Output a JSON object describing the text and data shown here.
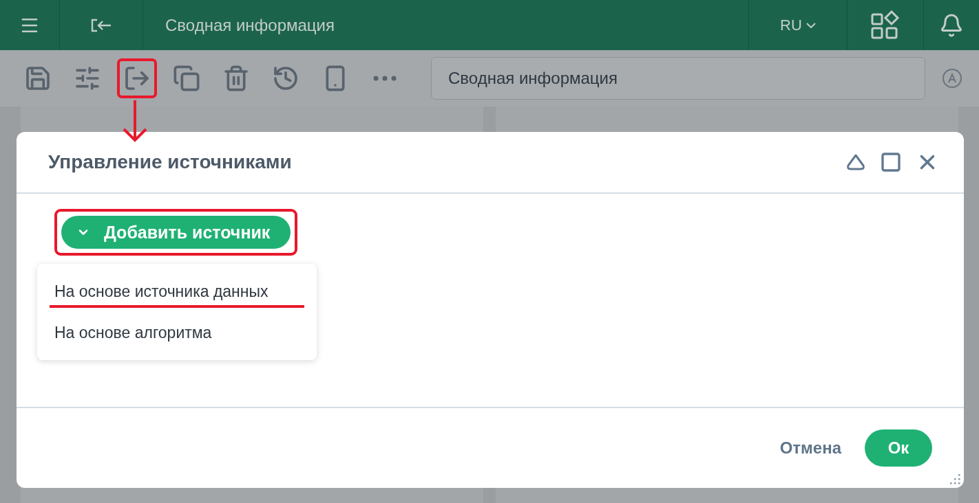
{
  "header": {
    "title": "Сводная информация",
    "language": "RU"
  },
  "toolbar": {
    "items": [
      {
        "kind": "save",
        "highlighted": false
      },
      {
        "kind": "settings",
        "highlighted": false
      },
      {
        "kind": "export",
        "highlighted": true
      },
      {
        "kind": "copy",
        "highlighted": false
      },
      {
        "kind": "delete",
        "highlighted": false
      },
      {
        "kind": "history",
        "highlighted": false
      },
      {
        "kind": "mobile",
        "highlighted": false
      },
      {
        "kind": "more",
        "highlighted": false
      }
    ],
    "name_field": {
      "value": "Сводная информация"
    }
  },
  "dialog": {
    "title": "Управление источниками",
    "add_button": {
      "label": "Добавить источник",
      "expanded": true
    },
    "menu": [
      {
        "label": "На основе источника данных",
        "selected": true
      },
      {
        "label": "На основе алгоритма",
        "selected": false
      }
    ],
    "cancel_button": "Отмена",
    "ok_button": "Ок"
  }
}
